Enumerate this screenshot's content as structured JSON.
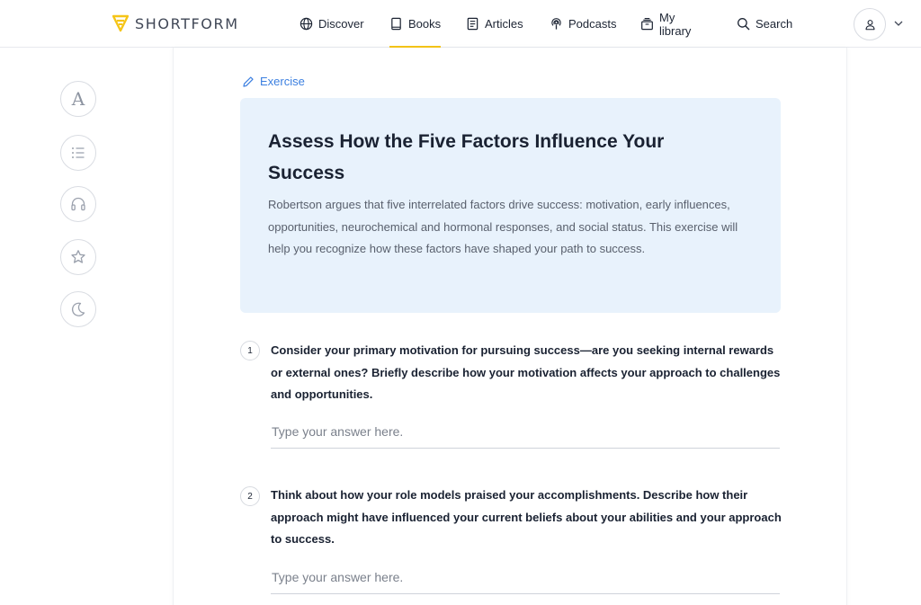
{
  "brand": {
    "name": "SHORTFORM",
    "color": "#f5c518"
  },
  "nav": [
    {
      "label": "Discover",
      "icon": "globe-icon",
      "active": false
    },
    {
      "label": "Books",
      "icon": "book-icon",
      "active": true
    },
    {
      "label": "Articles",
      "icon": "article-icon",
      "active": false
    },
    {
      "label": "Podcasts",
      "icon": "podcast-icon",
      "active": false
    },
    {
      "label": "My library",
      "icon": "library-icon",
      "active": false
    },
    {
      "label": "Search",
      "icon": "search-icon",
      "active": false
    }
  ],
  "tools": {
    "font_glyph": "A",
    "items": [
      "font-settings-icon",
      "table-of-contents-icon",
      "audio-headphones-icon",
      "favorite-star-icon",
      "dark-mode-moon-icon"
    ]
  },
  "exercise": {
    "label": "Exercise",
    "title": "Assess How the Five Factors Influence Your Success",
    "description": "Robertson argues that five interrelated factors drive success: motivation, early influences, opportunities, neurochemical and hormonal responses, and social status. This exercise will help you recognize how these factors have shaped your path to success.",
    "accent": "#3b7fe0",
    "callout_bg": "#e8f2fc"
  },
  "questions": [
    {
      "number": "1",
      "text": "Consider your primary motivation for pursuing success—are you seeking internal rewards or external ones? Briefly describe how your motivation affects your approach to challenges and opportunities.",
      "placeholder": "Type your answer here."
    },
    {
      "number": "2",
      "text": "Think about how your role models praised your accomplishments. Describe how their approach might have influenced your current beliefs about your abilities and your approach to success.",
      "placeholder": "Type your answer here."
    }
  ]
}
